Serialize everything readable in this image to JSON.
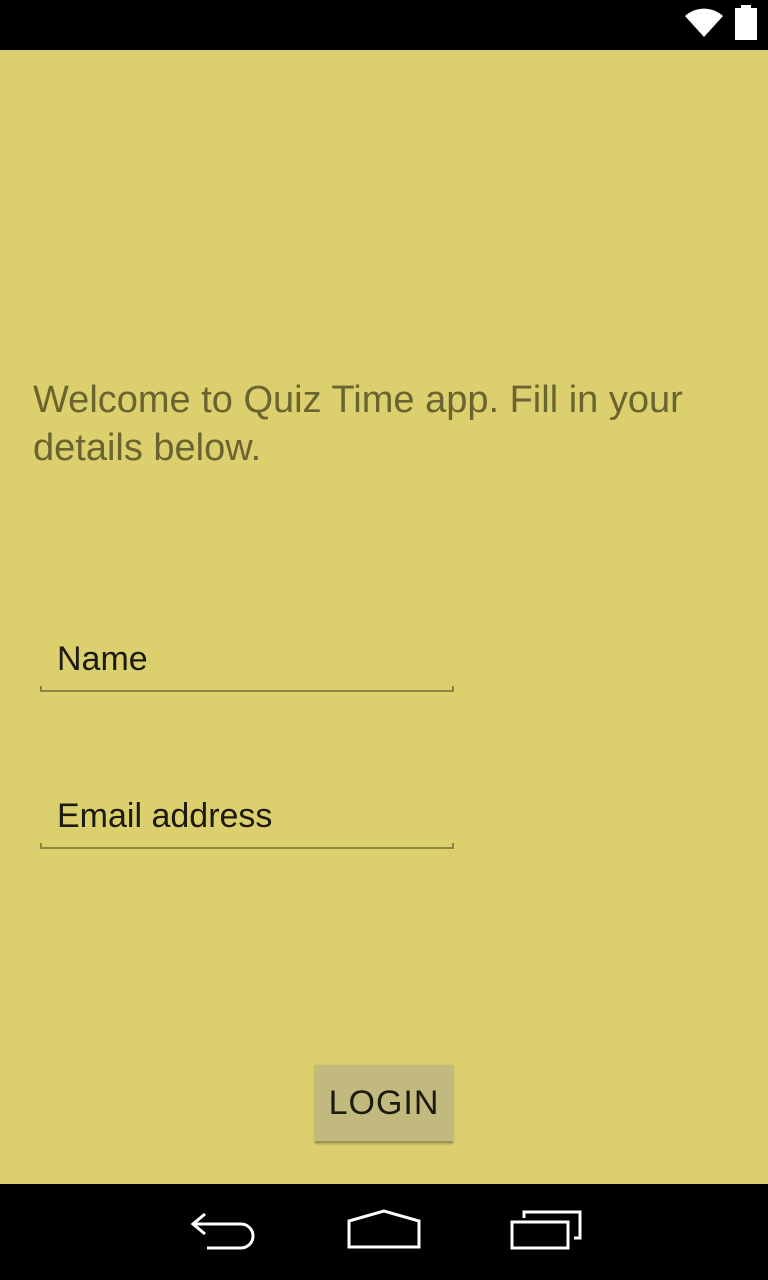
{
  "status_bar": {
    "icons": [
      "wifi-icon",
      "battery-icon"
    ]
  },
  "welcome_text": "Welcome to Quiz Time app. Fill in your details below.",
  "form": {
    "name_placeholder": "Name",
    "email_placeholder": "Email address",
    "login_label": "LOGIN"
  },
  "nav_bar": {
    "buttons": [
      "back-icon",
      "home-icon",
      "recent-apps-icon"
    ]
  },
  "colors": {
    "background": "#dccf6d",
    "welcome_text": "#6a6431",
    "button": "#c2b97f",
    "bars": "#000000"
  }
}
